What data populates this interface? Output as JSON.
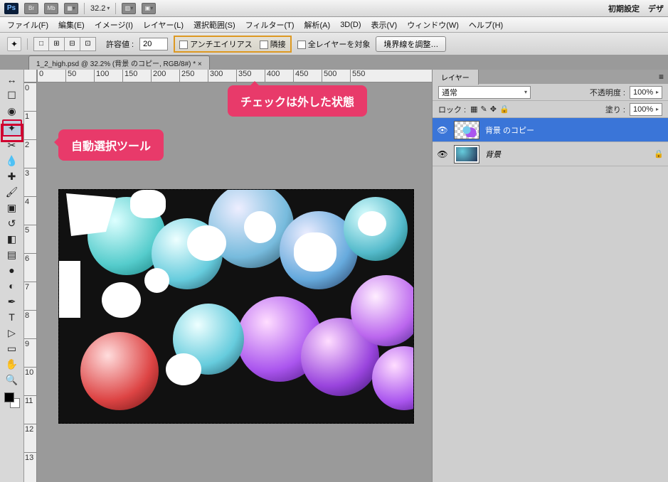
{
  "appbar": {
    "logo": "Ps",
    "br_btn": "Br",
    "mb_btn": "Mb",
    "zoom": "32.2",
    "right_initial": "初期設定",
    "right_design": "デザ"
  },
  "menu": {
    "file": "ファイル(F)",
    "edit": "編集(E)",
    "image": "イメージ(I)",
    "layer": "レイヤー(L)",
    "select": "選択範囲(S)",
    "filter": "フィルター(T)",
    "analysis": "解析(A)",
    "threeD": "3D(D)",
    "view": "表示(V)",
    "window": "ウィンドウ(W)",
    "help": "ヘルプ(H)"
  },
  "options": {
    "tolerance_label": "許容値 :",
    "tolerance_value": "20",
    "antialias": "アンチエイリアス",
    "contiguous": "隣接",
    "all_layers": "全レイヤーを対象",
    "refine": "境界線を調整…"
  },
  "doctab": "1_2_high.psd @ 32.2% (背景 のコピー, RGB/8#) * ×",
  "ruler_h": [
    "0",
    "50",
    "100",
    "150",
    "200",
    "250",
    "300",
    "350",
    "400",
    "450",
    "500",
    "550"
  ],
  "ruler_v": [
    "0",
    "1",
    "2",
    "3",
    "4",
    "5",
    "6",
    "7",
    "8",
    "9",
    "10",
    "11",
    "12",
    "13"
  ],
  "panels": {
    "tab_layers": "レイヤー",
    "blend_mode": "通常",
    "opacity_label": "不透明度 :",
    "opacity_value": "100%",
    "lock_label": "ロック :",
    "fill_label": "塗り :",
    "fill_value": "100%",
    "layer1_name": "背景 のコピー",
    "layer2_name": "背景"
  },
  "callouts": {
    "unchecked": "チェックは外した状態",
    "magicwand": "自動選択ツール"
  },
  "icons": {
    "move": "↔",
    "marquee": "☐",
    "lasso": "◉",
    "wand": "✦",
    "crop": "✂",
    "eyedrop": "💧",
    "heal": "✚",
    "brush": "🖌",
    "stamp": "▣",
    "history": "↺",
    "eraser": "◧",
    "grad": "▤",
    "blur": "●",
    "dodge": "◐",
    "pen": "✒",
    "type": "T",
    "path": "▷",
    "rect": "▭",
    "hand": "✋",
    "zoomt": "🔍"
  }
}
